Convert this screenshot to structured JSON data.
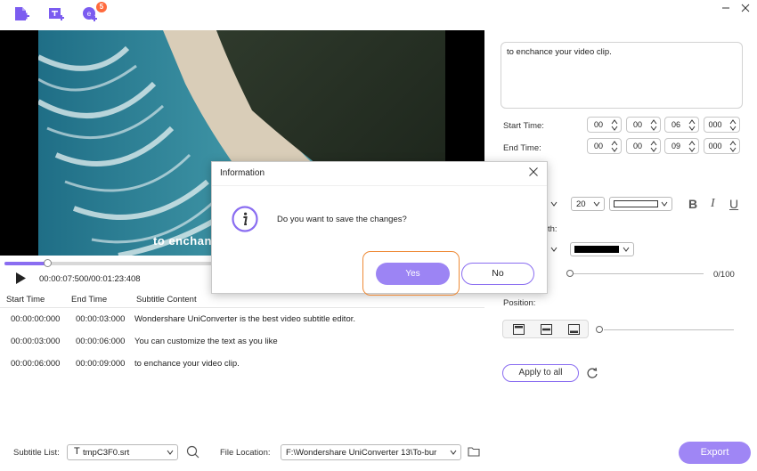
{
  "toolbar": {
    "add_file_icon": "add-file-icon",
    "add_subtitle_icon": "add-subtitle-icon",
    "add_more_icon": "add-more-icon",
    "badge_count": "5"
  },
  "video": {
    "subtitle_overlay": "to enchan",
    "progress": 0.09,
    "timecode": "00:00:07:500/00:01:23:408"
  },
  "subtitle_table": {
    "headers": [
      "Start Time",
      "End Time",
      "Subtitle Content"
    ],
    "rows": [
      {
        "start": "00:00:00:000",
        "end": "00:00:03:000",
        "content": "Wondershare UniConverter is the best video subtitle editor."
      },
      {
        "start": "00:00:03:000",
        "end": "00:00:06:000",
        "content": "You can customize the text as you like"
      },
      {
        "start": "00:00:06:000",
        "end": "00:00:09:000",
        "content": "to enchance your video clip."
      }
    ]
  },
  "editor": {
    "text": "to enchance your video clip.",
    "start_label": "Start Time:",
    "end_label": "End Time:",
    "start": [
      "00",
      "00",
      "06",
      "000"
    ],
    "end": [
      "00",
      "00",
      "09",
      "000"
    ],
    "font_size": "20",
    "outline_label_partial": "th:",
    "opacity_value": "0/100",
    "position_label": "Position:",
    "apply_label": "Apply to all",
    "color_swatch": "#ffffff",
    "outline_color": "#000000"
  },
  "bottom": {
    "subtitle_list_label": "Subtitle List:",
    "subtitle_file": "tmpC3F0.srt",
    "file_location_label": "File Location:",
    "file_location": "F:\\Wondershare UniConverter 13\\To-bur",
    "export_label": "Export"
  },
  "dialog": {
    "title": "Information",
    "message": "Do you want to save the changes?",
    "yes_label": "Yes",
    "no_label": "No"
  },
  "colors": {
    "accent": "#8a6df1",
    "highlight_ring": "#ee8a36"
  }
}
